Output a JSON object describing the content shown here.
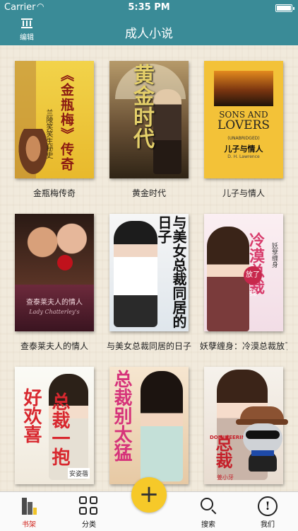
{
  "status_bar": {
    "carrier": "Carrier",
    "time": "5:35 PM",
    "wifi_icon": "wifi-icon",
    "battery_icon": "battery-icon"
  },
  "nav": {
    "title": "成人小说",
    "edit_label": "编辑",
    "edit_icon": "library-icon",
    "bar_color": "#3a8b97"
  },
  "books": [
    {
      "title": "金瓶梅传奇",
      "cover_text": "《金瓶梅》传奇",
      "cover_sub": "兰陵笑笑生秘史"
    },
    {
      "title": "黄金时代",
      "cover_text": "黄金时代"
    },
    {
      "title": "儿子与情人",
      "cover_line1": "SONS AND",
      "cover_line2": "LOVERS",
      "cover_unabridged": "(UNABRIDGED)",
      "cover_zh": "儿子与情人",
      "cover_author": "D. H. Lawrence"
    },
    {
      "title": "查泰莱夫人的情人",
      "cover_text": "查泰莱夫人的情人",
      "cover_en": "Lady Chatterley's"
    },
    {
      "title": "与美女总裁同居的日子",
      "cover_text": "与美女总裁同居的日子"
    },
    {
      "title": "妖孽缠身：冷漠总裁放了我",
      "cover_text": "冷漠总裁",
      "cover_badge": "放了我",
      "cover_side": "妖孽缠身"
    },
    {
      "title": "",
      "cover_text_a": "好欢喜",
      "cover_text_b": "总裁一抱",
      "cover_author": "安姿蓓"
    },
    {
      "title": "",
      "cover_text": "总裁别太猛"
    },
    {
      "title": "",
      "cover_text": "总裁",
      "cover_fancy": "DOMINEERING",
      "cover_author": "姜小牙"
    }
  ],
  "tabs": [
    {
      "label": "书架",
      "icon": "bookshelf-icon",
      "active": true
    },
    {
      "label": "分类",
      "icon": "category-grid-icon",
      "active": false
    },
    {
      "label": "搜索",
      "icon": "search-icon",
      "active": false
    },
    {
      "label": "我们",
      "icon": "info-icon",
      "active": false
    }
  ],
  "fab": {
    "label": "+",
    "icon": "add-icon",
    "color": "#f6c929"
  },
  "accent_active": "#d0221b"
}
